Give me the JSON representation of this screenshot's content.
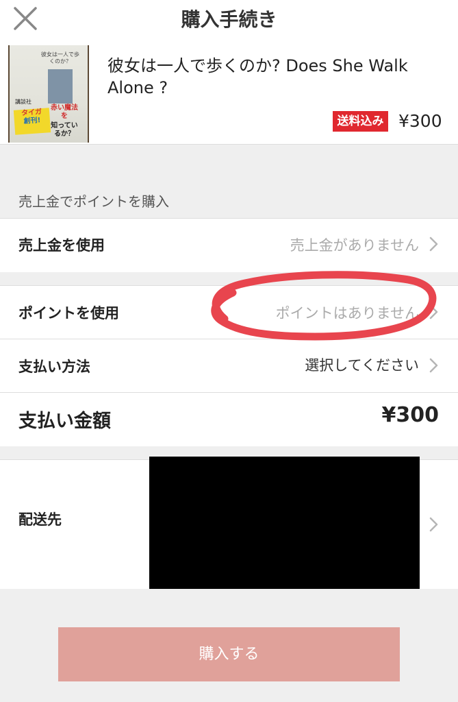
{
  "header": {
    "title": "購入手続き",
    "close_icon": "close-icon"
  },
  "product": {
    "title": "彼女は一人で歩くのか? Does She Walk Alone ?",
    "badge": "送料込み",
    "price": "¥300",
    "badge_color": "#e0282f",
    "cover": {
      "top_text": "彼女は一人で歩くのか？",
      "publisher": "講談社",
      "brand": "タイガ",
      "brand_suffix": "創刊!",
      "red_text": "赤い魔法を",
      "black_text": "知っているか？"
    }
  },
  "points_section": {
    "caption": "売上金でポイントを購入"
  },
  "rows": {
    "sales": {
      "label": "売上金を使用",
      "value": "売上金がありません"
    },
    "points": {
      "label": "ポイントを使用",
      "value": "ポイントはありません"
    },
    "payment": {
      "label": "支払い方法",
      "value": "選択してください"
    },
    "total": {
      "label": "支払い金額",
      "value": "¥300"
    },
    "shipping": {
      "label": "配送先"
    }
  },
  "button": {
    "label": "購入する",
    "color": "#e0a19a"
  }
}
